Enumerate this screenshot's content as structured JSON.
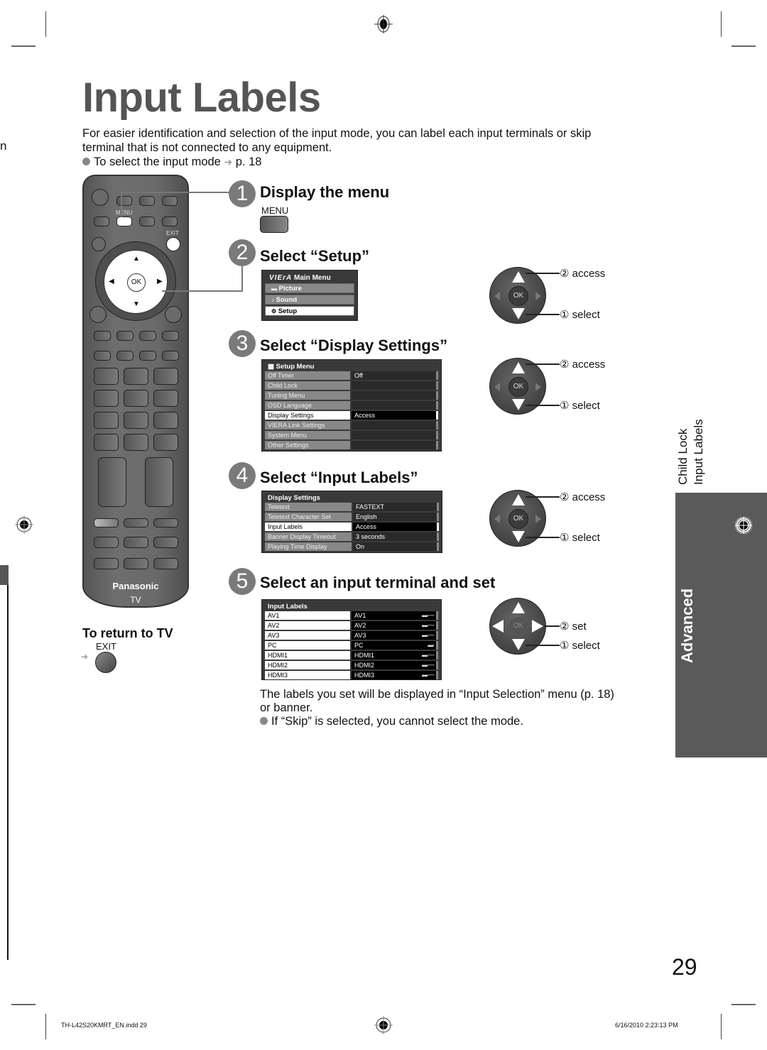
{
  "page": {
    "title": "Input Labels",
    "intro_line1": "For easier identification and selection of the input mode, you can label each input terminals or skip",
    "intro_line2": "terminal that is not connected to any equipment.",
    "intro_bullet": "To select the input mode",
    "intro_ref": "p. 18",
    "cut_text": "n",
    "page_number": "29"
  },
  "remote": {
    "menu_label": "MENU",
    "exit_label": "EXIT",
    "ok_label": "OK",
    "brand": "Panasonic",
    "brand_sub": "TV"
  },
  "return_to_tv": {
    "title": "To return to TV",
    "button_label": "EXIT"
  },
  "steps": [
    {
      "number": "1",
      "title": "Display the menu",
      "key_label": "MENU"
    },
    {
      "number": "2",
      "title": "Select “Setup”"
    },
    {
      "number": "3",
      "title": "Select “Display Settings”"
    },
    {
      "number": "4",
      "title": "Select “Input Labels”"
    },
    {
      "number": "5",
      "title": "Select an input terminal and set"
    }
  ],
  "main_menu": {
    "logo": "VIErA",
    "title": "Main Menu",
    "items": [
      {
        "label": "Picture",
        "selected": false
      },
      {
        "label": "Sound",
        "selected": false
      },
      {
        "label": "Setup",
        "selected": true
      }
    ]
  },
  "setup_menu": {
    "title": "Setup Menu",
    "rows": [
      {
        "label": "Off Timer",
        "value": "Off"
      },
      {
        "label": "Child Lock",
        "value": ""
      },
      {
        "label": "Tuning Menu",
        "value": ""
      },
      {
        "label": "OSD Language",
        "value": ""
      },
      {
        "label": "Display Settings",
        "value": "Access",
        "selected": true
      },
      {
        "label": "VIERA Link Settings",
        "value": ""
      },
      {
        "label": "System Menu",
        "value": ""
      },
      {
        "label": "Other Settings",
        "value": ""
      }
    ]
  },
  "display_settings": {
    "title": "Display Settings",
    "rows": [
      {
        "label": "Teletext",
        "value": "FASTEXT"
      },
      {
        "label": "Teletext Character Set",
        "value": "English"
      },
      {
        "label": "Input Labels",
        "value": "Access",
        "selected": true
      },
      {
        "label": "Banner Display Timeout",
        "value": "3 seconds"
      },
      {
        "label": "Playing Time Display",
        "value": "On"
      }
    ]
  },
  "input_labels": {
    "title": "Input Labels",
    "rows": [
      {
        "label": "AV1",
        "value": "AV1",
        "bar": "▬------"
      },
      {
        "label": "AV2",
        "value": "AV2",
        "bar": "▬------"
      },
      {
        "label": "AV3",
        "value": "AV3",
        "bar": "▬------"
      },
      {
        "label": "PC",
        "value": "PC",
        "bar": "▬-"
      },
      {
        "label": "HDMI1",
        "value": "HDMI1",
        "bar": "▬------"
      },
      {
        "label": "HDMI2",
        "value": "HDMI2",
        "bar": "▬------"
      },
      {
        "label": "HDMI3",
        "value": "HDMI3",
        "bar": "▬------"
      }
    ]
  },
  "pads": [
    {
      "ok": "OK",
      "top": "② access",
      "bottom": "① select"
    },
    {
      "ok": "OK",
      "top": "② access",
      "bottom": "① select"
    },
    {
      "ok": "OK",
      "top": "② access",
      "bottom": "① select"
    },
    {
      "ok": "OK",
      "top": "② set",
      "bottom": "① select"
    }
  ],
  "note": {
    "line1": "The labels you set will be displayed in “Input Selection” menu (p. 18)",
    "line2": "or banner.",
    "bullet": "If “Skip” is selected, you cannot select the mode."
  },
  "side": {
    "label1": "Child Lock",
    "label2": "Input Labels",
    "tab": "Advanced"
  },
  "footer": {
    "file": "TH-L42S20KMRT_EN.indd   29",
    "date": "6/16/2010   2:23:13 PM"
  }
}
